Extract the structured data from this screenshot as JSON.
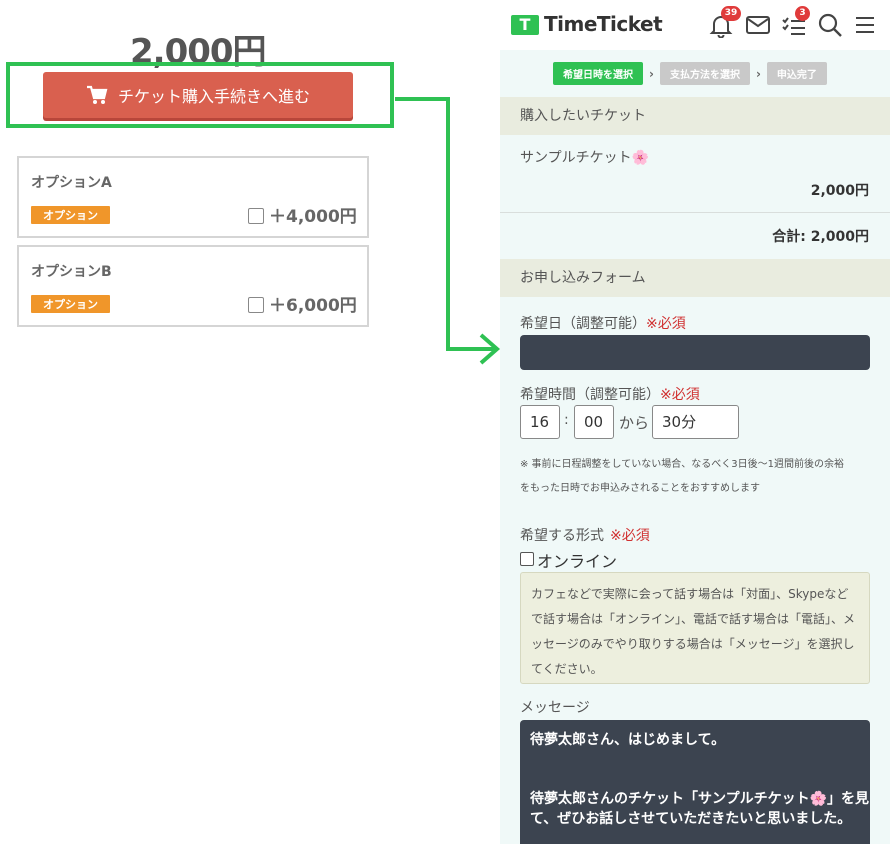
{
  "left": {
    "price": "2,000円",
    "buy_button_label": "チケット購入手続きへ進む",
    "options": [
      {
        "title": "オプションA",
        "badge": "オプション",
        "price": "＋4,000円"
      },
      {
        "title": "オプションB",
        "badge": "オプション",
        "price": "＋6,000円"
      }
    ]
  },
  "header": {
    "logo_mark": "T",
    "logo_text": "TimeTicket",
    "bell_badge": "39",
    "todo_badge": "3"
  },
  "steps": [
    "希望日時を選択",
    "支払方法を選択",
    "申込完了"
  ],
  "purchase": {
    "section_title": "購入したいチケット",
    "ticket_name": "サンプルチケット🌸",
    "ticket_price": "2,000円",
    "total_label": "合計: 2,000円"
  },
  "form": {
    "section_title": "お申し込みフォーム",
    "date_label": "希望日（調整可能）",
    "time_label": "希望時間（調整可能）",
    "required": "※必須",
    "hour": "16",
    "time_sep": ":",
    "minute": "00",
    "from_label": "から",
    "duration": "30分",
    "note_line1": "※ 事前に日程調整をしていない場合、なるべく3日後〜1週間前後の余裕",
    "note_line2": "をもった日時でお申込みされることをおすすめします",
    "format_label": "希望する形式",
    "online_label": "オンライン",
    "info_text": "カフェなどで実際に会って話す場合は「対面」、Skypeなどで話す場合は「オンライン」、電話で話す場合は「電話」、メッセージのみでやり取りする場合は「メッセージ」を選択してください。",
    "message_label": "メッセージ",
    "message_line1": "待夢太郎さん、はじめまして。",
    "message_line2": "待夢太郎さんのチケット「サンプルチケット🌸」を見て、ぜひお話しさせていただきたいと思いました。"
  },
  "colors": {
    "brand_green": "#2fc153",
    "buy_button": "#d9604f",
    "badge_orange": "#f0962a",
    "required_red": "#d03030"
  }
}
